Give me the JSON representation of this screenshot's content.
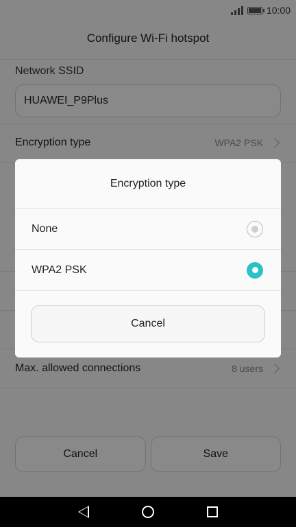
{
  "status_bar": {
    "time": "10:00",
    "icons": [
      "signal-icon",
      "battery-icon"
    ]
  },
  "header": {
    "title": "Configure Wi-Fi hotspot"
  },
  "form": {
    "ssid_label": "Network SSID",
    "ssid_value": "HUAWEI_P9Plus",
    "encryption_label": "Encryption type",
    "encryption_value": "WPA2 PSK",
    "max_connections_label": "Max. allowed connections",
    "max_connections_value": "8 users"
  },
  "bottom_buttons": {
    "cancel": "Cancel",
    "save": "Save"
  },
  "dialog": {
    "title": "Encryption type",
    "options": [
      {
        "label": "None",
        "selected": false
      },
      {
        "label": "WPA2 PSK",
        "selected": true
      }
    ],
    "cancel_label": "Cancel"
  },
  "colors": {
    "accent": "#2bc2c6",
    "overlay": "rgba(0,0,0,0.45)",
    "nav_bar": "#000000"
  },
  "nav_bar": {
    "icons": [
      "back-icon",
      "home-icon",
      "recent-apps-icon"
    ]
  }
}
